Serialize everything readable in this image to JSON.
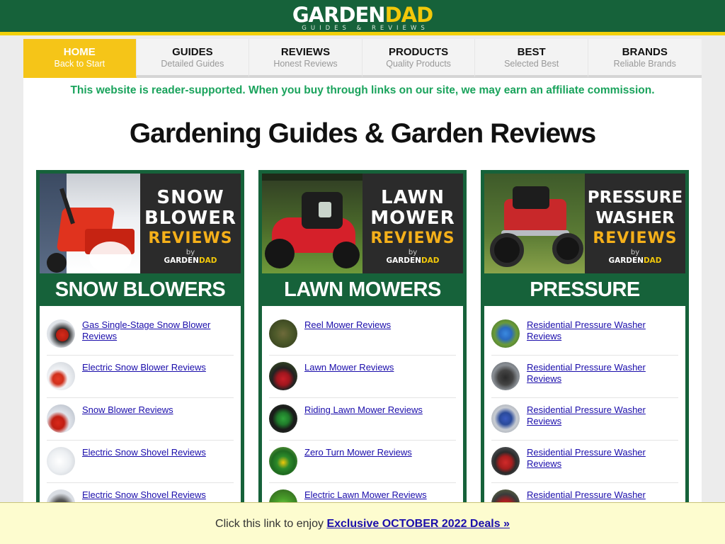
{
  "header": {
    "logo_part1": "GARDEN",
    "logo_part2": "DAD",
    "tagline": "GUIDES & REVIEWS"
  },
  "nav": [
    {
      "title": "HOME",
      "subtitle": "Back to Start",
      "active": true
    },
    {
      "title": "GUIDES",
      "subtitle": "Detailed Guides"
    },
    {
      "title": "REVIEWS",
      "subtitle": "Honest Reviews"
    },
    {
      "title": "PRODUCTS",
      "subtitle": "Quality Products"
    },
    {
      "title": "BEST",
      "subtitle": "Selected Best"
    },
    {
      "title": "BRANDS",
      "subtitle": "Reliable Brands"
    }
  ],
  "notice": "This website is reader-supported. When you buy through links on our site, we may earn an affiliate commission.",
  "page_title": "Gardening Guides & Garden Reviews",
  "cards": [
    {
      "banner_line1": "SNOW",
      "banner_line2": "BLOWER",
      "banner_line3": "REVIEWS",
      "banner_by": "by",
      "banner_brand1": "GARDEN",
      "banner_brand2": "DAD",
      "title": "SNOW BLOWERS",
      "items": [
        {
          "label": "Gas Single-Stage Snow Blower Reviews"
        },
        {
          "label": "Electric Snow Blower Reviews"
        },
        {
          "label": "Snow Blower Reviews"
        },
        {
          "label": "Electric Snow Shovel Reviews"
        },
        {
          "label": "Electric Snow Shovel Reviews"
        }
      ]
    },
    {
      "banner_line1": "LAWN",
      "banner_line2": "MOWER",
      "banner_line3": "REVIEWS",
      "banner_by": "by",
      "banner_brand1": "GARDEN",
      "banner_brand2": "DAD",
      "title": "LAWN MOWERS",
      "items": [
        {
          "label": "Reel Mower Reviews"
        },
        {
          "label": "Lawn Mower Reviews"
        },
        {
          "label": "Riding Lawn Mower Reviews"
        },
        {
          "label": "Zero Turn Mower Reviews"
        },
        {
          "label": "Electric Lawn Mower Reviews"
        }
      ]
    },
    {
      "banner_line1": "PRESSURE",
      "banner_line2": "WASHER",
      "banner_line3": "REVIEWS",
      "banner_by": "by",
      "banner_brand1": "GARDEN",
      "banner_brand2": "DAD",
      "title": "PRESSURE WASHERS",
      "items": [
        {
          "label": "Residential Pressure Washer Reviews"
        },
        {
          "label": "Residential Pressure Washer Reviews"
        },
        {
          "label": "Residential Pressure Washer Reviews"
        },
        {
          "label": "Residential Pressure Washer Reviews"
        },
        {
          "label": "Residential Pressure Washer"
        }
      ]
    }
  ],
  "promo": {
    "text": "Click this link to enjoy ",
    "link": "Exclusive OCTOBER 2022 Deals »"
  },
  "colors": {
    "brand_green": "#16623a",
    "accent_yellow": "#f5c518",
    "notice_green": "#1aa35c",
    "link_blue": "#1a0dab"
  }
}
